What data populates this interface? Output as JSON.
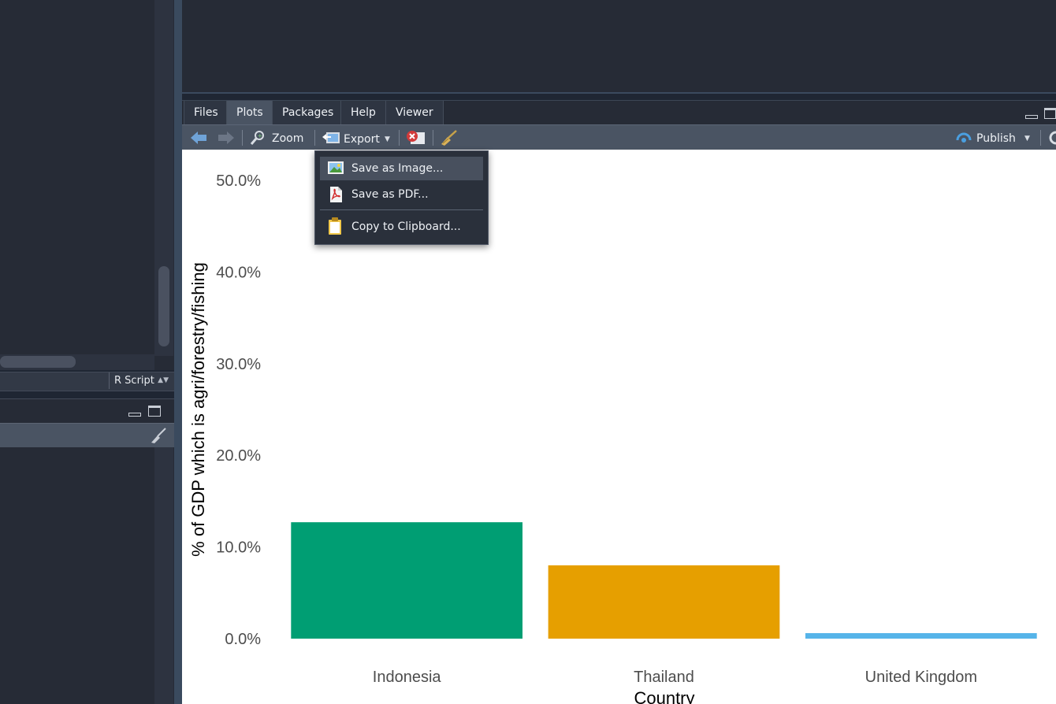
{
  "source_pane": {
    "file_type": "R Script"
  },
  "plots_pane": {
    "tabs": [
      {
        "label": "Files",
        "active": false
      },
      {
        "label": "Plots",
        "active": true
      },
      {
        "label": "Packages",
        "active": false
      },
      {
        "label": "Help",
        "active": false
      },
      {
        "label": "Viewer",
        "active": false
      }
    ],
    "toolbar": {
      "zoom_label": "Zoom",
      "export_label": "Export",
      "publish_label": "Publish"
    },
    "export_menu": {
      "items": [
        {
          "label": "Save as Image...",
          "icon": "image-icon",
          "highlighted": true
        },
        {
          "label": "Save as PDF...",
          "icon": "pdf-icon",
          "highlighted": false
        },
        {
          "label": "Copy to Clipboard...",
          "icon": "clipboard-icon",
          "highlighted": false
        }
      ]
    }
  },
  "chart_data": {
    "type": "bar",
    "categories": [
      "Indonesia",
      "Thailand",
      "United Kingdom"
    ],
    "values": [
      12.7,
      8.0,
      0.6
    ],
    "colors": [
      "#009E73",
      "#E69F00",
      "#56B4E9"
    ],
    "xlabel": "Country",
    "ylabel": "% of GDP which is agri/forestry/fishing",
    "yticks": [
      "0.0%",
      "10.0%",
      "20.0%",
      "30.0%",
      "40.0%",
      "50.0%"
    ],
    "ytick_values": [
      0,
      10,
      20,
      30,
      40,
      50
    ],
    "ylim": [
      0,
      50
    ]
  }
}
